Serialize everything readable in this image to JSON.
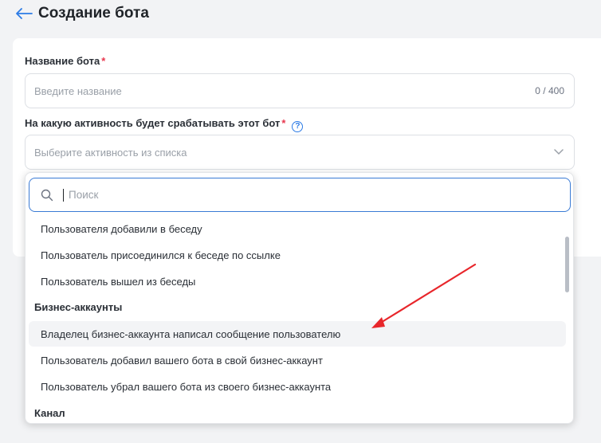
{
  "header": {
    "title": "Создание бота"
  },
  "form": {
    "name_label": "Название бота",
    "required_mark": "*",
    "name_placeholder": "Введите название",
    "name_counter": "0 / 400",
    "activity_label": "На какую активность будет срабатывать этот бот",
    "help_glyph": "?",
    "activity_placeholder": "Выберите активность из списка"
  },
  "dropdown": {
    "search_placeholder": "Поиск",
    "options_top": [
      "Пользователя добавили в беседу",
      "Пользователь присоединился к беседе по ссылке",
      "Пользователь вышел из беседы"
    ],
    "group_business": "Бизнес-аккаунты",
    "options_business": [
      "Владелец бизнес-аккаунта написал сообщение пользователю",
      "Пользователь добавил вашего бота в свой бизнес-аккаунт",
      "Пользователь убрал вашего бота из своего бизнес-аккаунта"
    ],
    "group_channel": "Канал"
  },
  "colors": {
    "accent": "#2c7be5",
    "required": "#e8384f",
    "annotation_arrow": "#e8262b"
  },
  "icons": {
    "back": "arrow-left-icon",
    "search": "search-icon",
    "help": "help-circle-icon",
    "chevron": "chevron-down-icon"
  }
}
